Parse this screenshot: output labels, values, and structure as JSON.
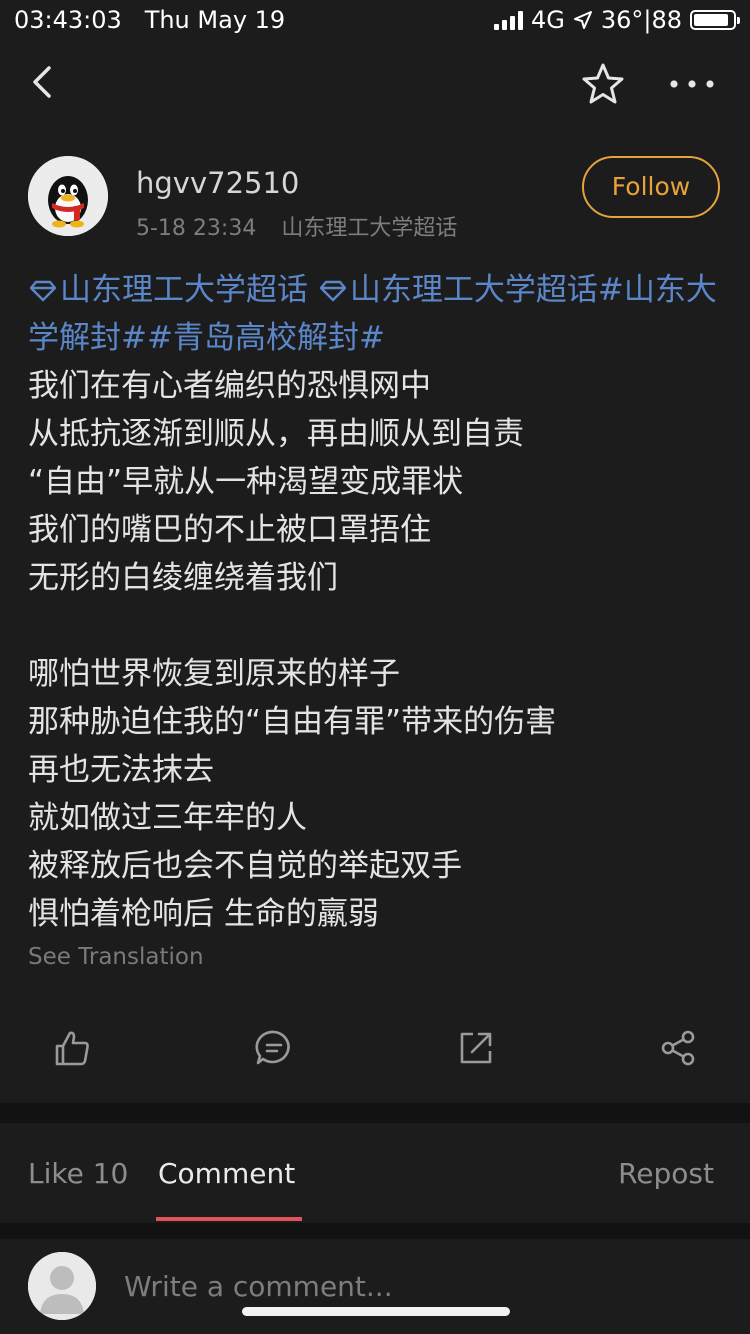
{
  "status_bar": {
    "time": "03:43:03",
    "date": "Thu May 19",
    "network": "4G",
    "temperature_battery": "36°|88",
    "battery_level": 0.88
  },
  "nav": {
    "back_icon": "chevron-left-icon",
    "favorite_icon": "star-icon",
    "more_icon": "more-dots-icon"
  },
  "post": {
    "username": "hgvv72510",
    "timestamp": "5-18 23:34",
    "source": "山东理工大学超话",
    "follow_label": "Follow",
    "tags_line": [
      "山东理工大学超话",
      "山东理工大学超话",
      "#山东大学解封##青岛高校解封#"
    ],
    "paragraph1": [
      "我们在有心者编织的恐惧网中",
      "从抵抗逐渐到顺从，再由顺从到自责",
      "“自由”早就从一种渴望变成罪状",
      "我们的嘴巴的不止被口罩捂住",
      "无形的白绫缠绕着我们"
    ],
    "paragraph2": [
      "哪怕世界恢复到原来的样子",
      "那种胁迫住我的“自由有罪”带来的伤害",
      "再也无法抹去",
      "就如做过三年牢的人",
      "被释放后也会不自觉的举起双手",
      "惧怕着枪响后 生命的羸弱"
    ],
    "see_translation": "See Translation"
  },
  "actions": {
    "like_icon": "thumbs-up-icon",
    "comment_icon": "comment-icon",
    "repost_icon": "repost-icon",
    "share_icon": "share-icon"
  },
  "tabs": {
    "like": "Like 10",
    "comment": "Comment",
    "repost": "Repost"
  },
  "comment_bar": {
    "placeholder": "Write a comment..."
  },
  "colors": {
    "background": "#1c1c1d",
    "accent": "#e6a23c",
    "link": "#5b87c9",
    "tab_underline": "#e0525a"
  }
}
